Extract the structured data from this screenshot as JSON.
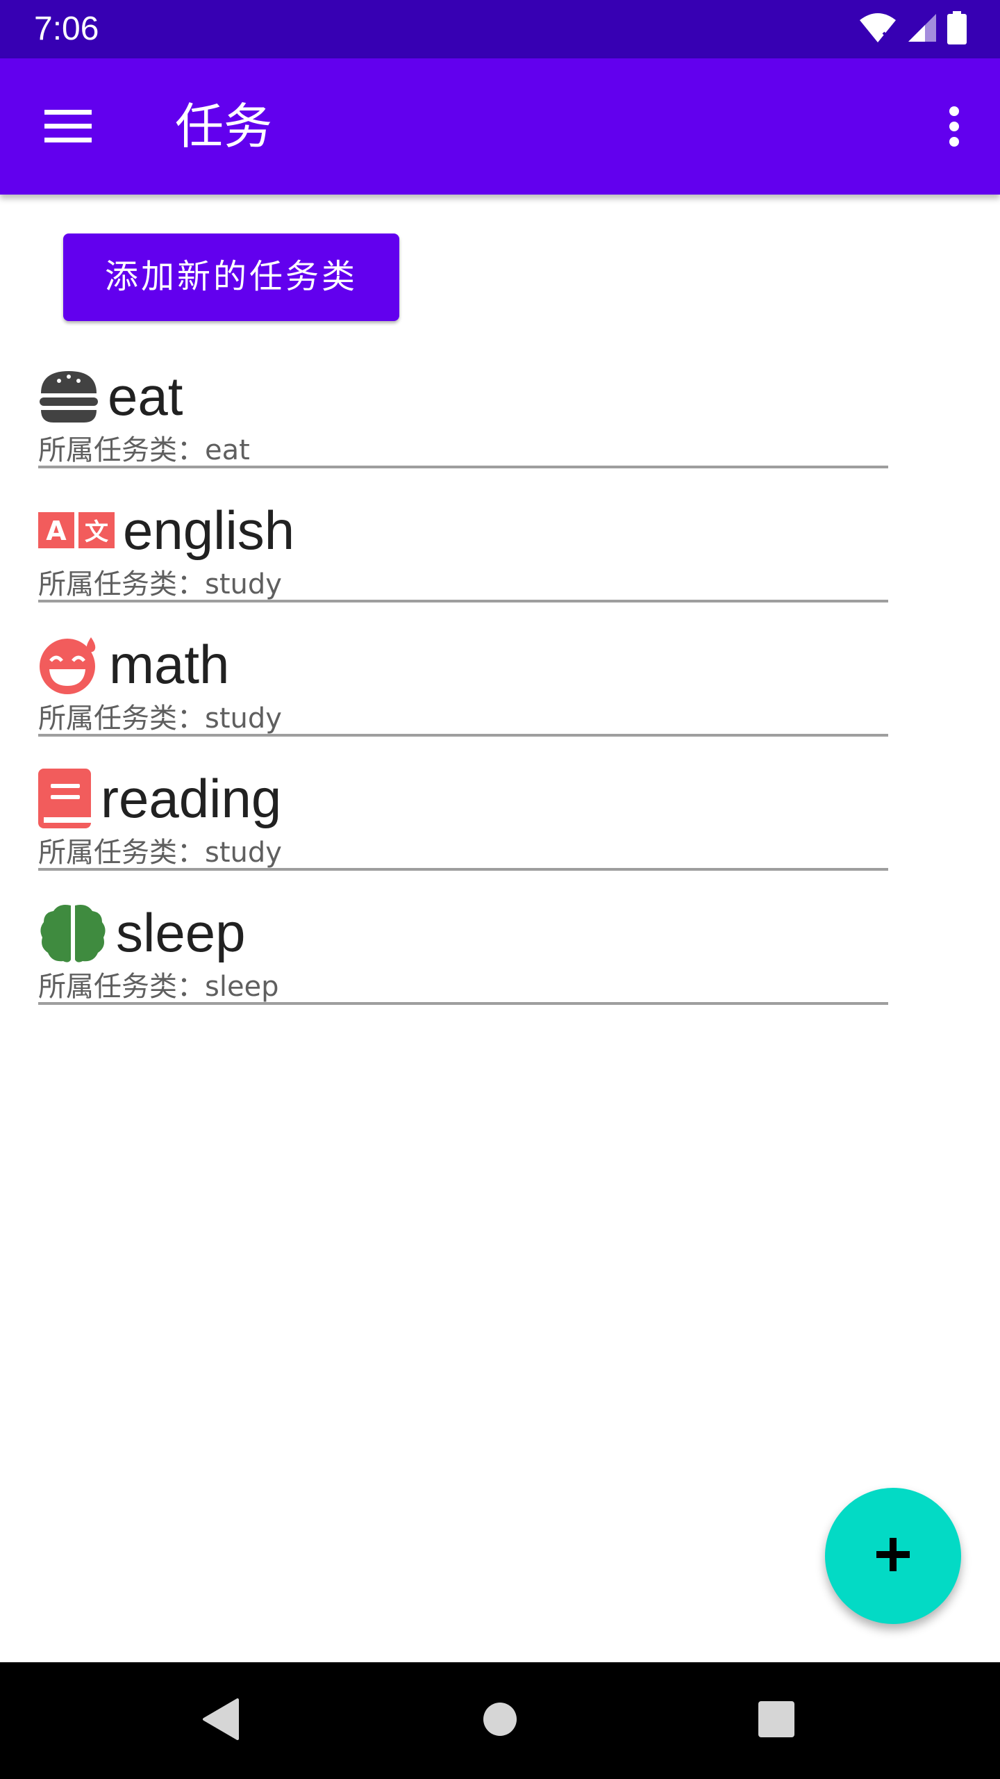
{
  "status_bar": {
    "time": "7:06",
    "icons": [
      "wifi-icon",
      "signal-icon",
      "battery-icon"
    ]
  },
  "app_bar": {
    "title": "任务",
    "menu_icon": "hamburger-menu-icon",
    "overflow_icon": "more-vertical-icon"
  },
  "add_category_button": {
    "label": "添加新的任务类"
  },
  "tasks": [
    {
      "name": "eat",
      "category_line": "所属任务类：eat",
      "icon": "burger-icon",
      "icon_color": "#424242"
    },
    {
      "name": "english",
      "category_line": "所属任务类：study",
      "icon": "translate-icon",
      "icon_color": "#f25c5c"
    },
    {
      "name": "math",
      "category_line": "所属任务类：study",
      "icon": "sweat-smile-icon",
      "icon_color": "#f25c5c"
    },
    {
      "name": "reading",
      "category_line": "所属任务类：study",
      "icon": "book-icon",
      "icon_color": "#f25c5c"
    },
    {
      "name": "sleep",
      "category_line": "所属任务类：sleep",
      "icon": "brain-icon",
      "icon_color": "#3f8b3f"
    }
  ],
  "fab": {
    "icon": "plus-icon",
    "color": "#03dac5"
  },
  "nav_bar": {
    "back_icon": "back-triangle-icon",
    "home_icon": "home-circle-icon",
    "recents_icon": "recents-square-icon"
  },
  "colors": {
    "status_bar": "#3700b3",
    "primary": "#6200ee",
    "accent": "#03dac5"
  }
}
